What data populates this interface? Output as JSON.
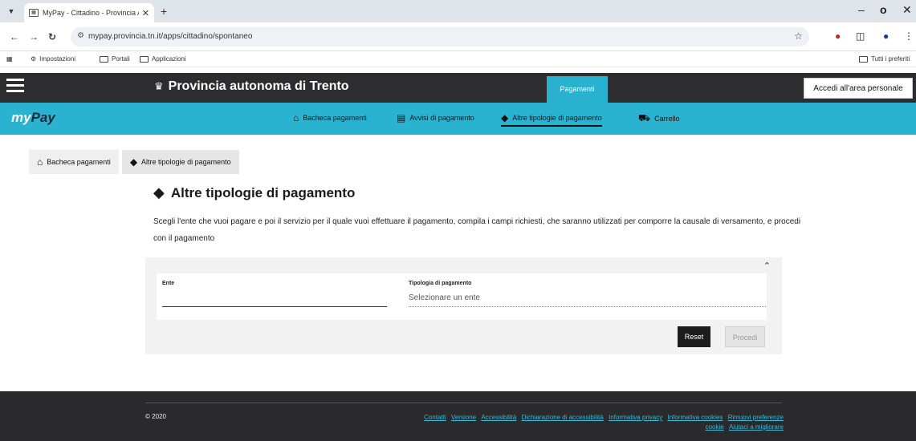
{
  "browser": {
    "tab_title": "MyPay - Cittadino - Provincia A",
    "url": "mypay.provincia.tn.it/apps/cittadino/spontaneo",
    "bookmarks": [
      "Impostazioni",
      "Portali",
      "Applicazioni"
    ],
    "all_bookmarks": "Tutti i preferiti"
  },
  "header": {
    "province_name": "Provincia autonoma di Trento",
    "payments_tab": "Pagamenti",
    "login_button": "Accedi all'area personale"
  },
  "nav": {
    "logo_my": "my",
    "logo_pay": "Pay",
    "items": [
      {
        "label": "Bacheca pagamenti",
        "icon": "home-icon"
      },
      {
        "label": "Avvisi di pagamento",
        "icon": "document-icon"
      },
      {
        "label": "Altre tipologie di pagamento",
        "icon": "tags-icon",
        "active": true
      },
      {
        "label": "Carrello",
        "icon": "cart-icon"
      }
    ]
  },
  "breadcrumb": [
    "Bacheca pagamenti",
    "Altre tipologie di pagamento"
  ],
  "main": {
    "title": "Altre tipologie di pagamento",
    "intro": "Scegli l'ente che vuoi pagare e poi il servizio per il quale vuoi effettuare il pagamento, compila i campi richiesti, che saranno utilizzati per comporre la causale di versamento, e procedi con il pagamento",
    "form": {
      "ente_label": "Ente",
      "ente_value": "",
      "tipologia_label": "Tipologia di pagamento",
      "tipologia_placeholder": "Selezionare un ente",
      "reset_button": "Reset",
      "procedi_button": "Procedi"
    }
  },
  "footer": {
    "copyright": "© 2020",
    "links_line1": [
      "Contatti",
      "Versione",
      "Accessibilità",
      "Dichiarazione di accessibilità",
      "Informativa privacy",
      "Informativa cookies",
      "Rimuovi preferenze"
    ],
    "links_line2": [
      "cookie",
      "Aiutaci a migliorare"
    ]
  },
  "colors": {
    "accent": "#2ab3d1",
    "header_dark": "#2d2d2f",
    "footer_dark": "#2a2a2c",
    "link": "#39b6d4"
  }
}
